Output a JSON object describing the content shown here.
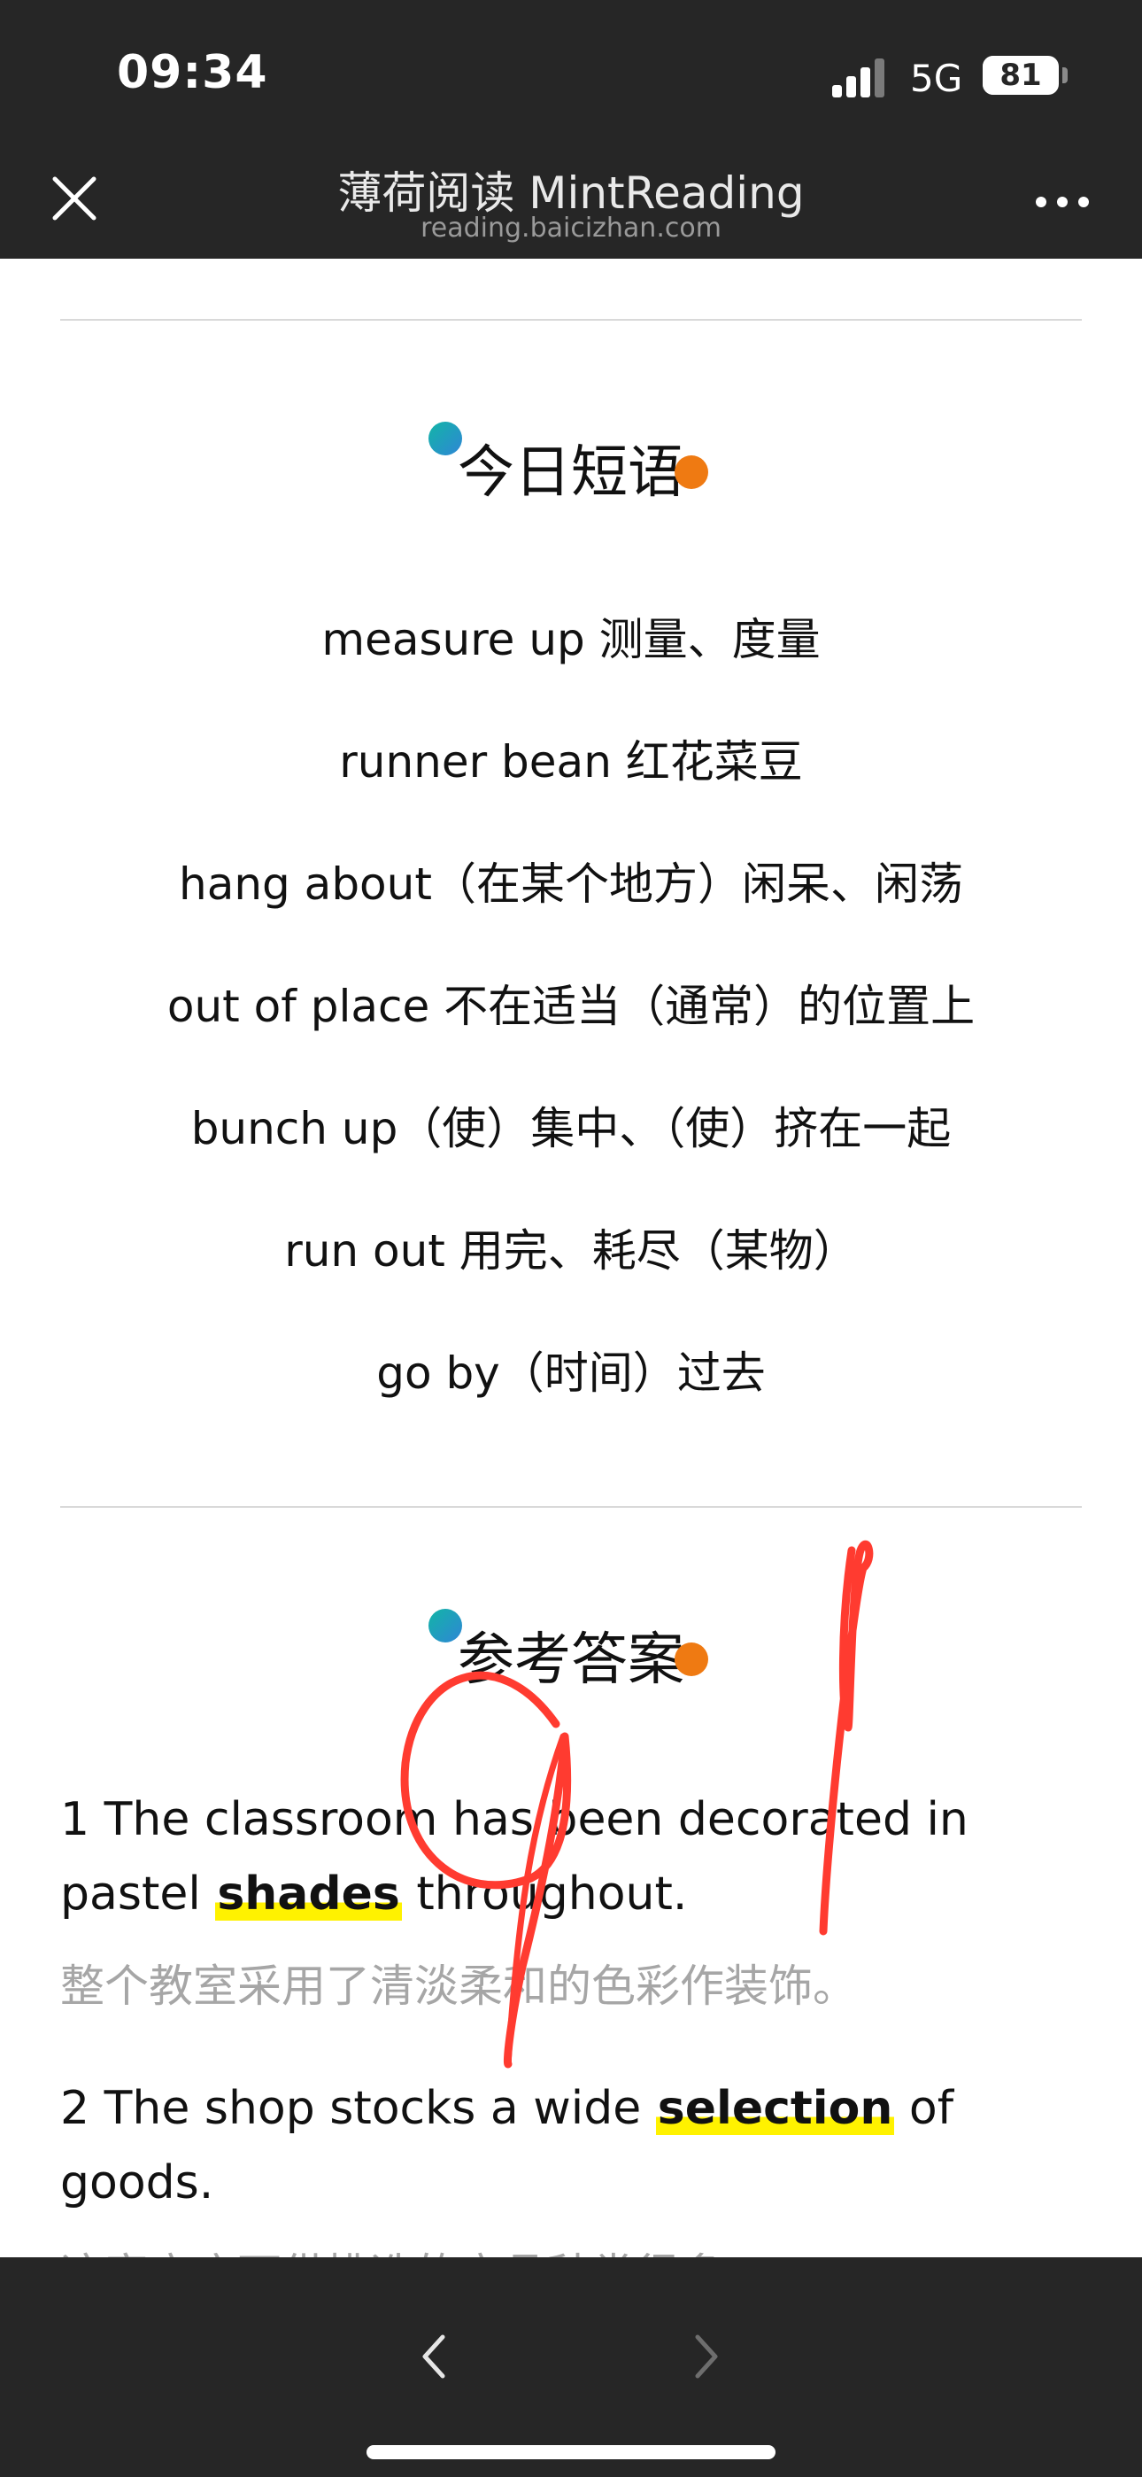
{
  "status_bar": {
    "time": "09:34",
    "network": "5G",
    "battery": "81",
    "battery_level": 0.81
  },
  "nav": {
    "title": "薄荷阅读 MintReading",
    "subtitle": "reading.baicizhan.com",
    "close_icon": "close-icon",
    "more_icon": "more-dots-icon"
  },
  "phrases_section": {
    "title": "今日短语",
    "items": [
      "measure up 测量、度量",
      "runner bean 红花菜豆",
      "hang about（在某个地方）闲呆、闲荡",
      "out of place 不在适当（通常）的位置上",
      "bunch up（使）集中、（使）挤在一起",
      "run out 用完、耗尽（某物）",
      "go by（时间）过去"
    ]
  },
  "answers_section": {
    "title": "参考答案",
    "answers": [
      {
        "before": "1 The classroom has been decorated in pastel ",
        "keyword": "shades",
        "after": " throughout.",
        "translation": "整个教室采用了清淡柔和的色彩作装饰。"
      },
      {
        "before": "2 The shop stocks a wide ",
        "keyword": "selection",
        "after": " of goods.",
        "translation": "这家商店可供挑选的商品种类很多。"
      }
    ]
  },
  "handwriting": {
    "text": "91",
    "color": "#ff3b30"
  },
  "bottom_bar": {
    "back_icon": "chevron-left-icon",
    "forward_icon": "chevron-right-icon"
  },
  "colors": {
    "bar_background": "#262626",
    "highlight": "#fff200",
    "accent_teal": "#12b5a6",
    "accent_orange": "#ef7a12",
    "translation_text": "#a6a6a6"
  }
}
